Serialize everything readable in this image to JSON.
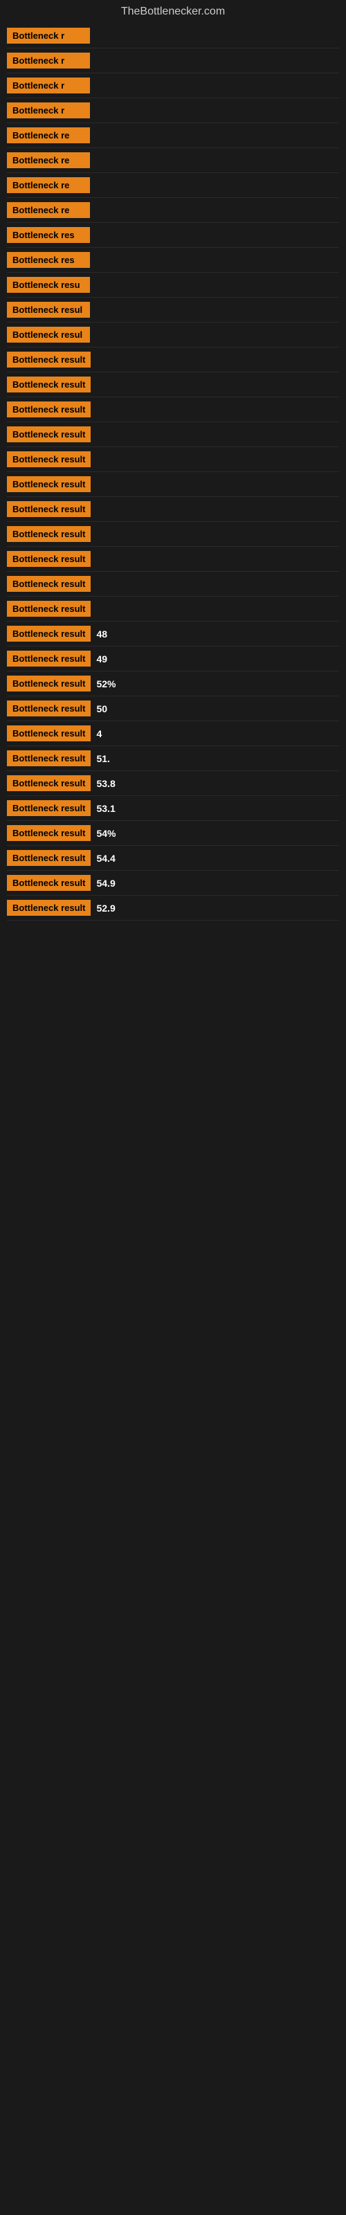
{
  "site": {
    "title": "TheBottlenecker.com"
  },
  "rows": [
    {
      "label": "Bottleneck r",
      "value": "",
      "barWidth": 0
    },
    {
      "label": "Bottleneck r",
      "value": "",
      "barWidth": 0
    },
    {
      "label": "Bottleneck r",
      "value": "",
      "barWidth": 0
    },
    {
      "label": "Bottleneck r",
      "value": "",
      "barWidth": 0
    },
    {
      "label": "Bottleneck re",
      "value": "",
      "barWidth": 0
    },
    {
      "label": "Bottleneck re",
      "value": "",
      "barWidth": 0
    },
    {
      "label": "Bottleneck re",
      "value": "",
      "barWidth": 0
    },
    {
      "label": "Bottleneck re",
      "value": "",
      "barWidth": 0
    },
    {
      "label": "Bottleneck res",
      "value": "",
      "barWidth": 0
    },
    {
      "label": "Bottleneck res",
      "value": "",
      "barWidth": 0
    },
    {
      "label": "Bottleneck resu",
      "value": "",
      "barWidth": 0
    },
    {
      "label": "Bottleneck resul",
      "value": "",
      "barWidth": 0
    },
    {
      "label": "Bottleneck resul",
      "value": "",
      "barWidth": 0
    },
    {
      "label": "Bottleneck result",
      "value": "",
      "barWidth": 0
    },
    {
      "label": "Bottleneck result",
      "value": "",
      "barWidth": 0
    },
    {
      "label": "Bottleneck result",
      "value": "",
      "barWidth": 0
    },
    {
      "label": "Bottleneck result",
      "value": "",
      "barWidth": 0
    },
    {
      "label": "Bottleneck result",
      "value": "",
      "barWidth": 0
    },
    {
      "label": "Bottleneck result",
      "value": "",
      "barWidth": 0
    },
    {
      "label": "Bottleneck result",
      "value": "",
      "barWidth": 0
    },
    {
      "label": "Bottleneck result",
      "value": "",
      "barWidth": 0
    },
    {
      "label": "Bottleneck result",
      "value": "",
      "barWidth": 0
    },
    {
      "label": "Bottleneck result",
      "value": "",
      "barWidth": 0
    },
    {
      "label": "Bottleneck result",
      "value": "",
      "barWidth": 0
    },
    {
      "label": "Bottleneck result",
      "value": "48",
      "barWidth": 25
    },
    {
      "label": "Bottleneck result",
      "value": "49",
      "barWidth": 26
    },
    {
      "label": "Bottleneck result",
      "value": "52%",
      "barWidth": 28
    },
    {
      "label": "Bottleneck result",
      "value": "50",
      "barWidth": 27
    },
    {
      "label": "Bottleneck result",
      "value": "4",
      "barWidth": 22
    },
    {
      "label": "Bottleneck result",
      "value": "51.",
      "barWidth": 27
    },
    {
      "label": "Bottleneck result",
      "value": "53.8",
      "barWidth": 29
    },
    {
      "label": "Bottleneck result",
      "value": "53.1",
      "barWidth": 29
    },
    {
      "label": "Bottleneck result",
      "value": "54%",
      "barWidth": 30
    },
    {
      "label": "Bottleneck result",
      "value": "54.4",
      "barWidth": 30
    },
    {
      "label": "Bottleneck result",
      "value": "54.9",
      "barWidth": 30
    },
    {
      "label": "Bottleneck result",
      "value": "52.9",
      "barWidth": 29
    }
  ]
}
